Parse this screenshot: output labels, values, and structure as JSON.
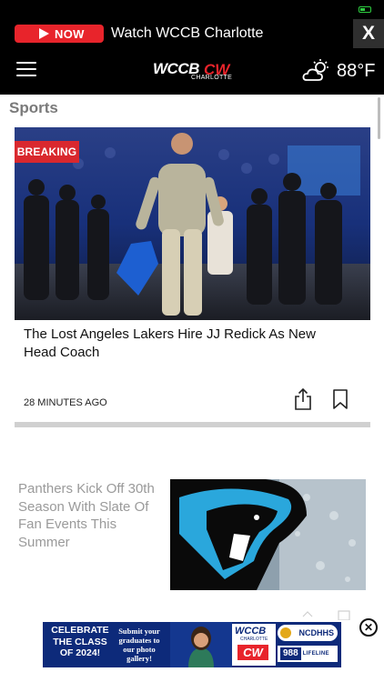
{
  "live_banner": {
    "now_label": "NOW",
    "watch_text": "Watch WCCB Charlotte",
    "close_label": "X"
  },
  "header": {
    "logo_main": "WCCB",
    "logo_cw": "CW",
    "logo_sub": "CHARLOTTE",
    "weather_icon": "partly-cloudy-icon",
    "temperature": "88°F"
  },
  "section": {
    "title": "Sports"
  },
  "hero_story": {
    "badge": "BREAKING",
    "headline": "The Lost Angeles Lakers Hire JJ Redick As New Head Coach",
    "timestamp": "28 MINUTES AGO",
    "share_icon": "share-icon",
    "bookmark_icon": "bookmark-icon"
  },
  "story_2": {
    "headline": "Panthers Kick Off 30th Season With Slate Of Fan Events This Summer"
  },
  "ad": {
    "line1": "CELEBRATE THE CLASS OF 2024!",
    "line2": "Submit your graduates to our photo gallery!",
    "wccb": "WCCB",
    "charlotte": "CHARLOTTE",
    "cw": "CW",
    "ncdhhs": "NCDHHS",
    "num_988": "988",
    "lifeline": "LIFELINE",
    "close_label": "✕"
  },
  "colors": {
    "accent_red": "#e8242b",
    "header_bg": "#000000",
    "panthers_blue": "#2aa7dc",
    "ad_blue": "#0d2a7a"
  }
}
